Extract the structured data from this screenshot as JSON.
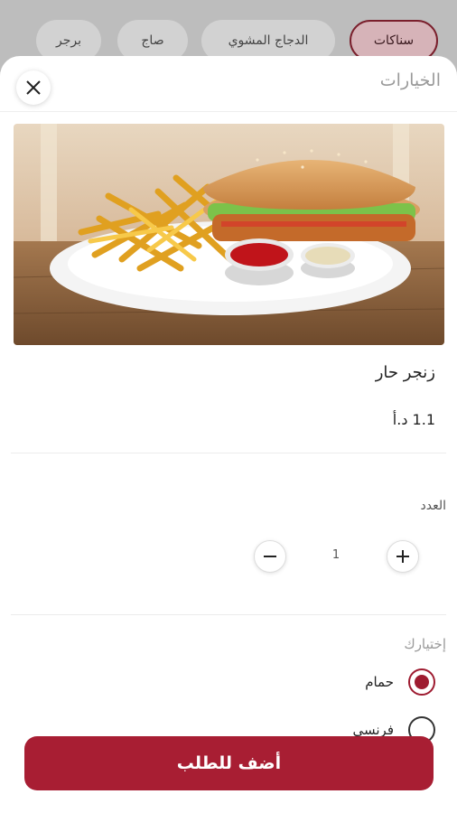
{
  "categories": [
    "سناكات",
    "الدجاج المشوي",
    "صاج",
    "برجر"
  ],
  "sheet": {
    "title": "الخيارات",
    "close_icon": "close-icon"
  },
  "product": {
    "name": "زنجر حار",
    "price": "1.1 د.أ",
    "image": "zinger sandwich with fries and dipping sauces"
  },
  "quantity": {
    "label": "العدد",
    "value": "1",
    "minus_icon": "minus-icon",
    "plus_icon": "plus-icon"
  },
  "options": {
    "label": "إختيارك",
    "items": [
      {
        "label": "حمام",
        "selected": true
      },
      {
        "label": "فرنسي",
        "selected": false
      }
    ]
  },
  "add_to_order": "أضف للطلب",
  "colors": {
    "accent": "#a81e33",
    "selected_radio": "#9e1b30"
  }
}
